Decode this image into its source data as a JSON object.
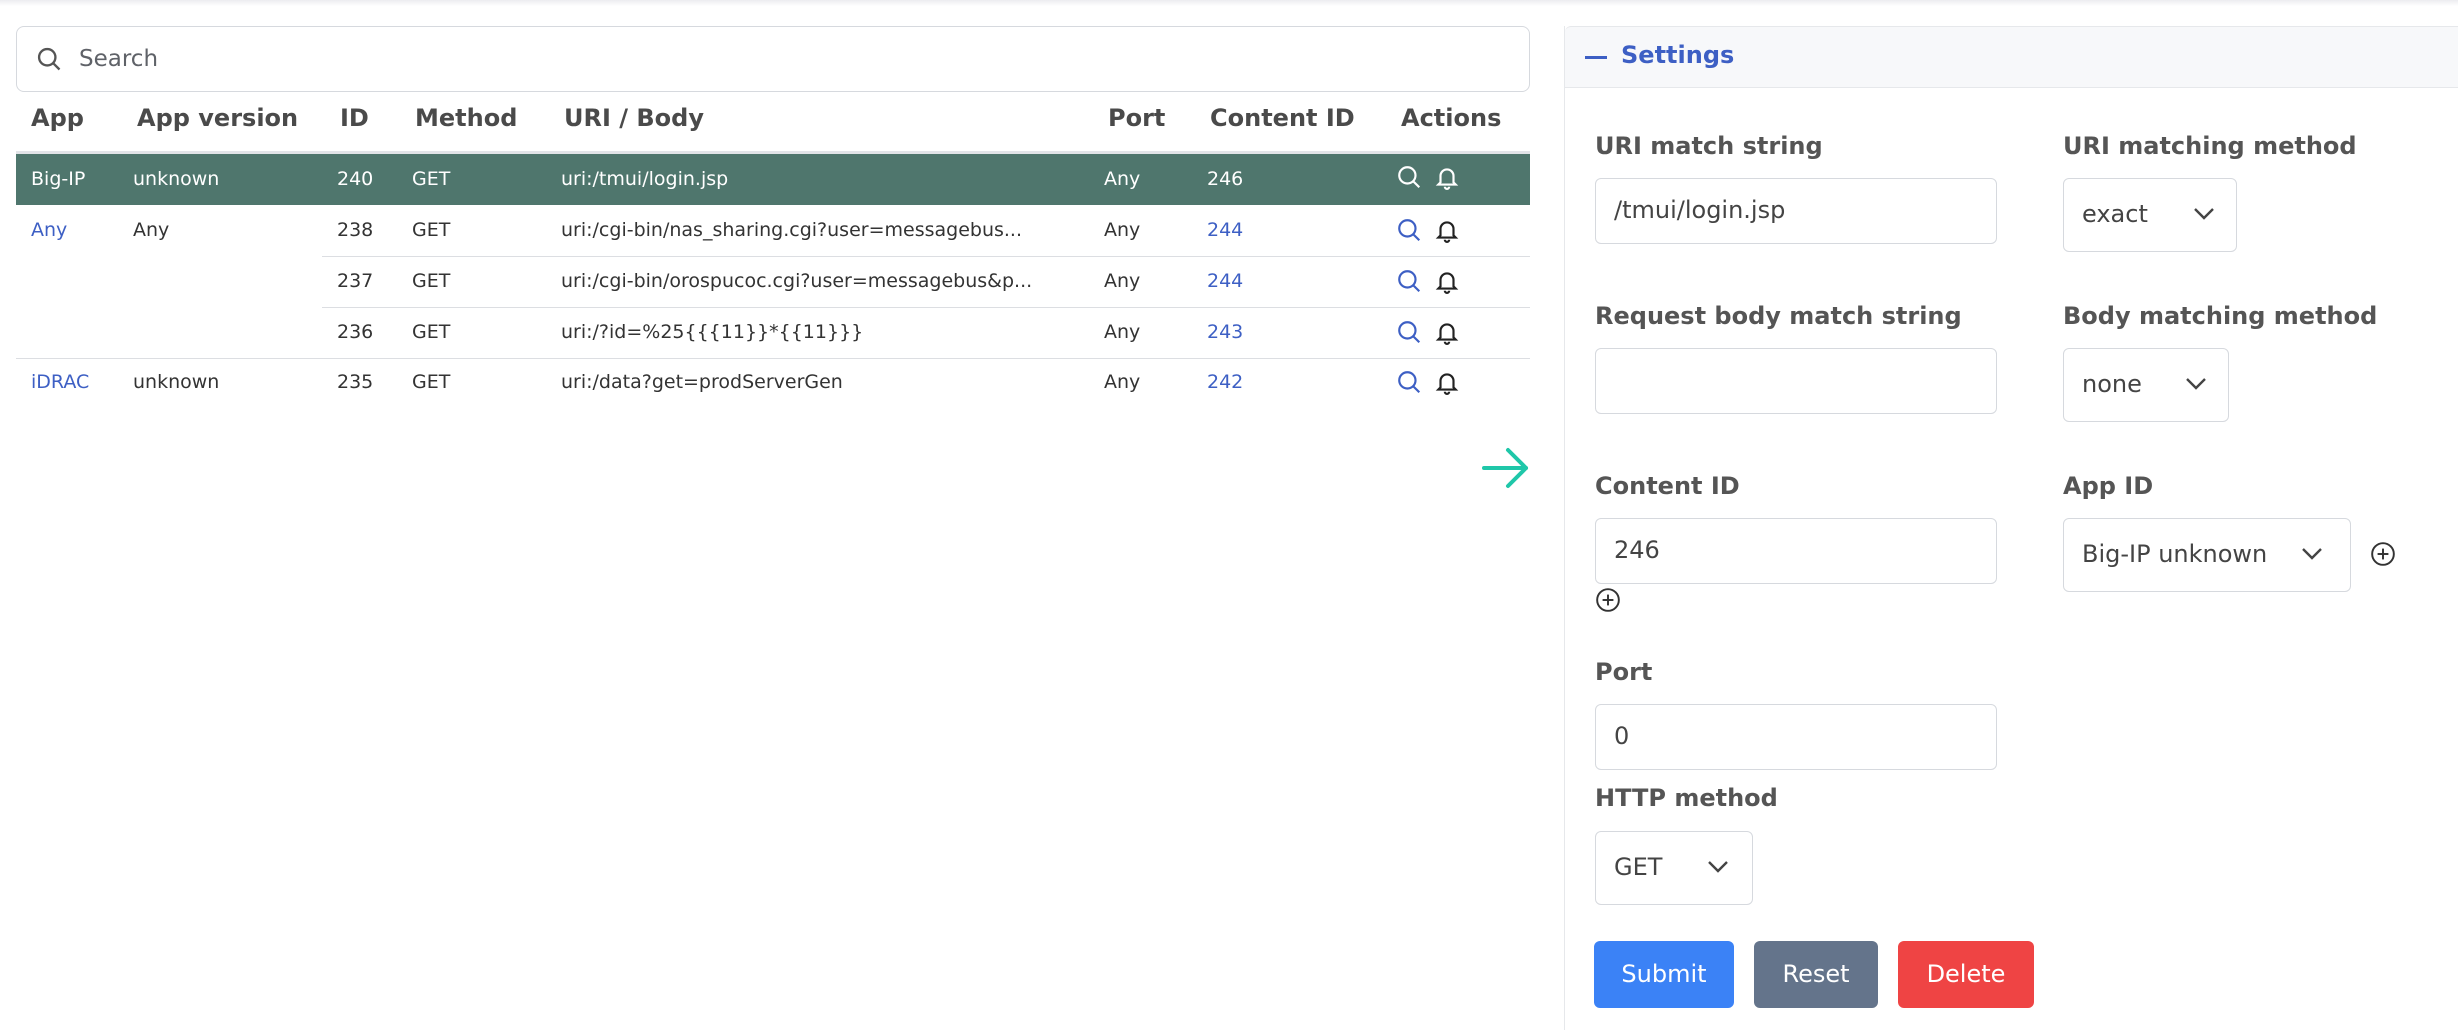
{
  "search": {
    "placeholder": "Search"
  },
  "table": {
    "headers": {
      "app": "App",
      "app_version": "App version",
      "id": "ID",
      "method": "Method",
      "uri_body": "URI / Body",
      "port": "Port",
      "content_id": "Content ID",
      "actions": "Actions"
    },
    "rows": [
      {
        "app": "Big-IP",
        "app_version": "unknown",
        "id": "240",
        "method": "GET",
        "uri": "uri:/tmui/login.jsp",
        "port": "Any",
        "content_id": "246",
        "selected": true
      },
      {
        "app": "Any",
        "app_version": "Any",
        "id": "238",
        "method": "GET",
        "uri": "uri:/cgi-bin/nas_sharing.cgi?user=messagebus...",
        "port": "Any",
        "content_id": "244"
      },
      {
        "app": "",
        "app_version": "",
        "id": "237",
        "method": "GET",
        "uri": "uri:/cgi-bin/orospucoc.cgi?user=messagebus&p...",
        "port": "Any",
        "content_id": "244"
      },
      {
        "app": "",
        "app_version": "",
        "id": "236",
        "method": "GET",
        "uri": "uri:/?id=%25{{{11}}*{{11}}}",
        "port": "Any",
        "content_id": "243"
      },
      {
        "app": "iDRAC",
        "app_version": "unknown",
        "id": "235",
        "method": "GET",
        "uri": "uri:/data?get=prodServerGen",
        "port": "Any",
        "content_id": "242"
      }
    ]
  },
  "settings": {
    "title": "Settings",
    "uri_match_label": "URI match string",
    "uri_match_value": "/tmui/login.jsp",
    "uri_method_label": "URI matching method",
    "uri_method_value": "exact",
    "body_match_label": "Request body match string",
    "body_match_value": "",
    "body_method_label": "Body matching method",
    "body_method_value": "none",
    "content_id_label": "Content ID",
    "content_id_value": "246",
    "app_id_label": "App ID",
    "app_id_value": "Big-IP unknown",
    "port_label": "Port",
    "port_value": "0",
    "http_method_label": "HTTP method",
    "http_method_value": "GET"
  },
  "buttons": {
    "submit": "Submit",
    "reset": "Reset",
    "delete": "Delete"
  },
  "colors": {
    "accent": "#3d5fc4",
    "selected_row": "#4f766d",
    "arrow": "#1fc7a9",
    "submit": "#3b82f6",
    "reset": "#64748b",
    "delete": "#ef4444"
  },
  "icons": {
    "search": "search-icon",
    "row_search": "magnifier-icon",
    "row_alert": "bell-icon",
    "arrow": "arrow-right-icon",
    "add": "plus-circle-icon",
    "dropdown": "chevron-down-icon",
    "collapse": "minus-icon"
  }
}
